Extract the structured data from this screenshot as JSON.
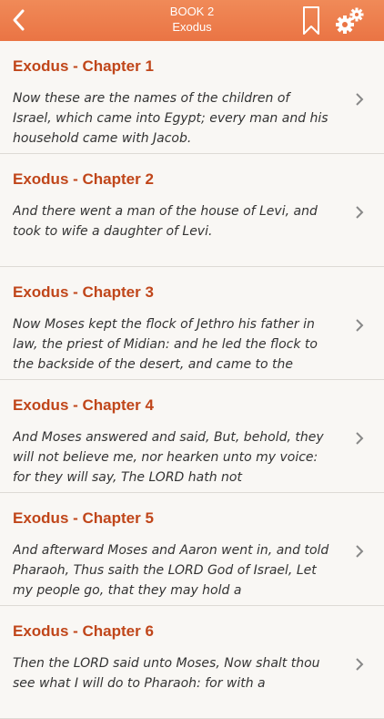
{
  "header": {
    "book_label": "BOOK 2",
    "book_name": "Exodus",
    "icons": [
      "back-chevron-icon",
      "bookmark-icon",
      "gear-icon"
    ],
    "color": "#ee7d4d"
  },
  "chapters": [
    {
      "title": "Exodus - Chapter 1",
      "text": "Now these are the names of the children of Israel, which came into Egypt; every man and his household came with Jacob."
    },
    {
      "title": "Exodus - Chapter 2",
      "text": "And there went a man of the house of Levi, and took to wife a daughter of Levi."
    },
    {
      "title": "Exodus - Chapter 3",
      "text": "Now Moses kept the flock of Jethro his father in law, the priest of Midian: and he led the flock to the backside of the desert, and came to the"
    },
    {
      "title": "Exodus - Chapter 4",
      "text": "And Moses answered and said, But, behold, they will not believe me, nor hearken unto my voice: for they will say, The LORD hath not"
    },
    {
      "title": "Exodus - Chapter 5",
      "text": "And afterward Moses and Aaron went in, and told Pharaoh, Thus saith the LORD God of Israel, Let my people go, that they may hold a"
    },
    {
      "title": "Exodus - Chapter 6",
      "text": "Then the LORD said unto Moses, Now shalt thou see what I will do to Pharaoh: for with a"
    }
  ]
}
